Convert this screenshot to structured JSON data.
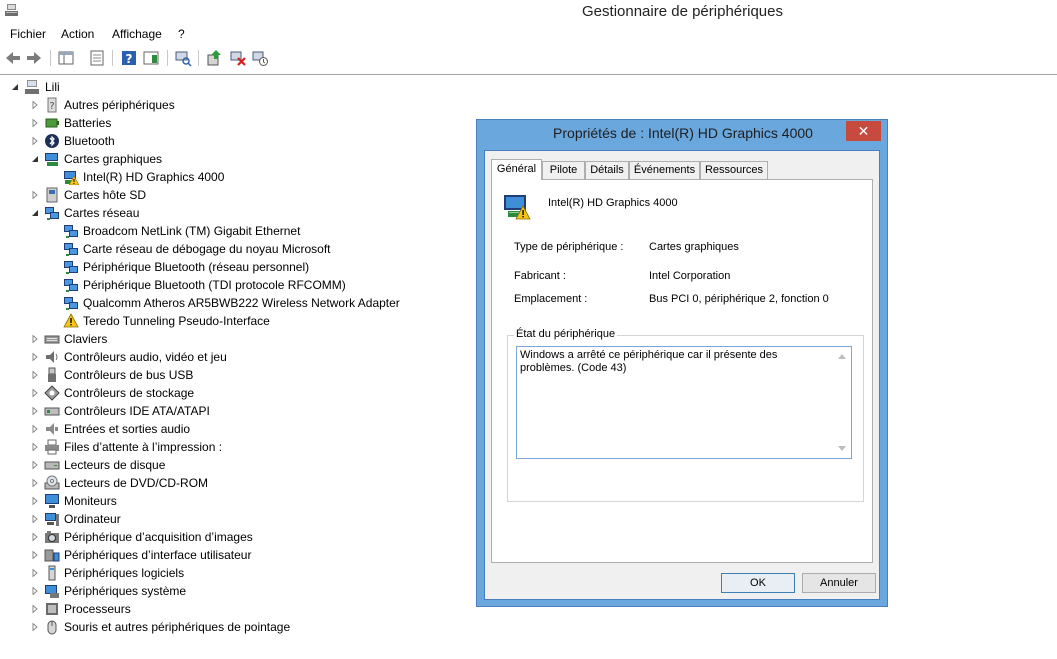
{
  "window": {
    "title": "Gestionnaire de périphériques"
  },
  "menu": [
    "Fichier",
    "Action",
    "Affichage",
    "?"
  ],
  "toolbar": {
    "icons": [
      "back-arrow-icon",
      "forward-arrow-icon",
      "show-hide-console-tree-icon",
      "properties-icon",
      "help-icon",
      "action-pane-icon",
      "scan-hardware-icon",
      "update-driver-icon",
      "uninstall-icon",
      "disable-icon"
    ]
  },
  "tree": {
    "root": "Lili",
    "nodes": [
      {
        "label": "Autres périphériques",
        "icon": "unknown-device-icon"
      },
      {
        "label": "Batteries",
        "icon": "battery-icon"
      },
      {
        "label": "Bluetooth",
        "icon": "bluetooth-icon"
      },
      {
        "label": "Cartes graphiques",
        "icon": "display-adapter-icon",
        "expanded": true,
        "children": [
          {
            "label": "Intel(R) HD Graphics 4000",
            "icon": "display-adapter-warning-icon"
          }
        ]
      },
      {
        "label": "Cartes hôte SD",
        "icon": "sd-host-icon"
      },
      {
        "label": "Cartes réseau",
        "icon": "network-adapter-icon",
        "expanded": true,
        "children": [
          {
            "label": "Broadcom NetLink (TM) Gigabit Ethernet",
            "icon": "network-adapter-icon"
          },
          {
            "label": "Carte réseau de débogage du noyau Microsoft",
            "icon": "network-adapter-icon"
          },
          {
            "label": "Périphérique Bluetooth (réseau personnel)",
            "icon": "network-adapter-icon"
          },
          {
            "label": "Périphérique Bluetooth (TDI protocole RFCOMM)",
            "icon": "network-adapter-icon"
          },
          {
            "label": "Qualcomm Atheros AR5BWB222 Wireless Network Adapter",
            "icon": "network-adapter-icon"
          },
          {
            "label": "Teredo Tunneling Pseudo-Interface",
            "icon": "warning-icon"
          }
        ]
      },
      {
        "label": "Claviers",
        "icon": "keyboard-icon"
      },
      {
        "label": "Contrôleurs audio, vidéo et jeu",
        "icon": "speaker-icon"
      },
      {
        "label": "Contrôleurs de bus USB",
        "icon": "usb-icon"
      },
      {
        "label": "Contrôleurs de stockage",
        "icon": "storage-controller-icon"
      },
      {
        "label": "Contrôleurs IDE ATA/ATAPI",
        "icon": "ide-controller-icon"
      },
      {
        "label": "Entrées et sorties audio",
        "icon": "audio-io-icon"
      },
      {
        "label": "Files d’attente à l’impression :",
        "icon": "printer-icon"
      },
      {
        "label": "Lecteurs de disque",
        "icon": "disk-drive-icon"
      },
      {
        "label": "Lecteurs de DVD/CD-ROM",
        "icon": "dvd-drive-icon"
      },
      {
        "label": "Moniteurs",
        "icon": "monitor-icon"
      },
      {
        "label": "Ordinateur",
        "icon": "computer-icon"
      },
      {
        "label": "Périphérique d’acquisition d’images",
        "icon": "camera-icon"
      },
      {
        "label": "Périphériques d’interface utilisateur",
        "icon": "hid-icon"
      },
      {
        "label": "Périphériques logiciels",
        "icon": "software-device-icon"
      },
      {
        "label": "Périphériques système",
        "icon": "system-device-icon"
      },
      {
        "label": "Processeurs",
        "icon": "processor-icon"
      },
      {
        "label": "Souris et autres périphériques de pointage",
        "icon": "mouse-icon"
      }
    ]
  },
  "dialog": {
    "title": "Propriétés de : Intel(R) HD Graphics 4000",
    "close": "✕",
    "tabs": [
      "Général",
      "Pilote",
      "Détails",
      "Événements",
      "Ressources"
    ],
    "active_tab": "Général",
    "device_name": "Intel(R) HD Graphics 4000",
    "props": [
      {
        "label": "Type de périphérique :",
        "value": "Cartes graphiques"
      },
      {
        "label": "Fabricant :",
        "value": "Intel Corporation"
      },
      {
        "label": "Emplacement :",
        "value": "Bus PCI 0, périphérique 2, fonction 0"
      }
    ],
    "status_group": "État du périphérique",
    "status_text": "Windows a arrêté ce périphérique car il présente des problèmes. (Code 43)",
    "ok": "OK",
    "cancel": "Annuler"
  }
}
